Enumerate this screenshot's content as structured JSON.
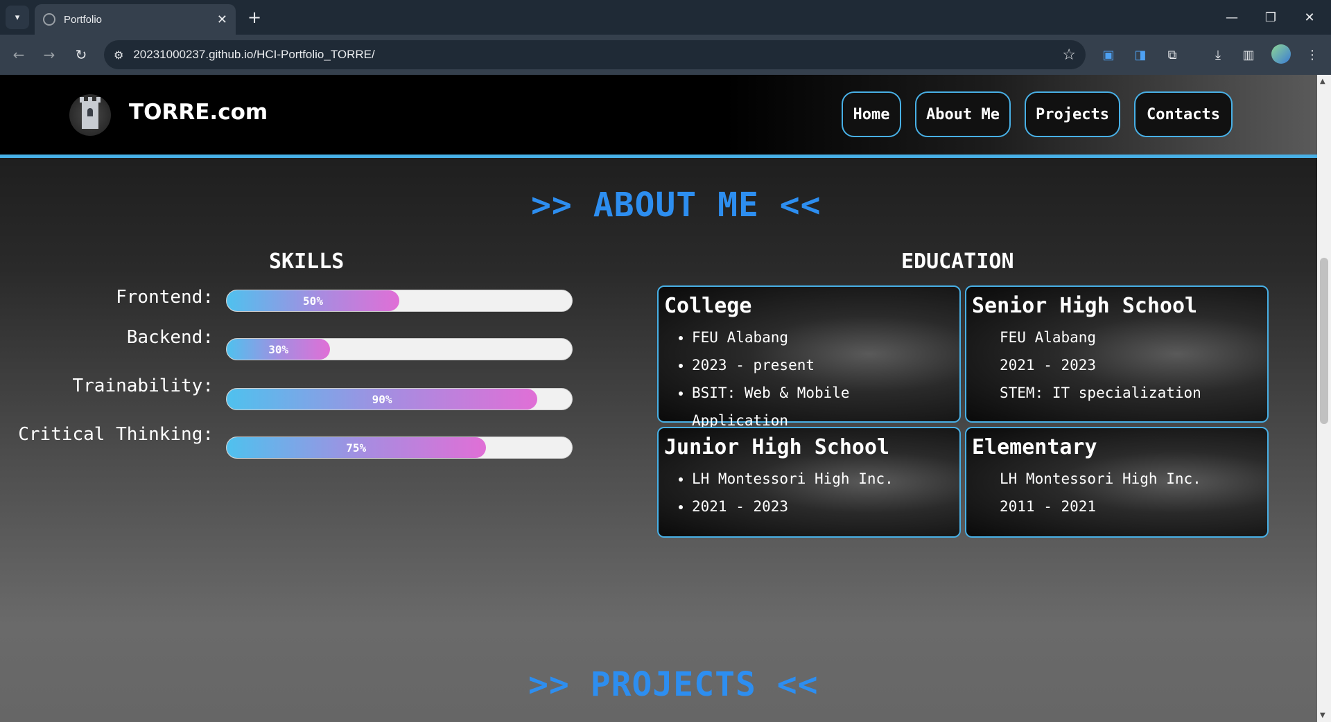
{
  "browser": {
    "tab_title": "Portfolio",
    "url": "20231000237.github.io/HCI-Portfolio_TORRE/"
  },
  "site": {
    "brand": "TORRE.com",
    "nav": [
      "Home",
      "About Me",
      "Projects",
      "Contacts"
    ]
  },
  "about": {
    "title": ">> ABOUT ME <<",
    "skills_heading": "SKILLS",
    "education_heading": "EDUCATION",
    "skills": [
      {
        "label": "Frontend:",
        "percent_text": "50%",
        "percent": 50
      },
      {
        "label": "Backend:",
        "percent_text": "30%",
        "percent": 30
      },
      {
        "label": "Trainability:",
        "percent_text": "90%",
        "percent": 90
      },
      {
        "label": "Critical Thinking:",
        "percent_text": "75%",
        "percent": 75
      }
    ],
    "education": [
      {
        "title": "College",
        "items": [
          "FEU Alabang",
          "2023 - present",
          "BSIT: Web & Mobile Application"
        ]
      },
      {
        "title": "Senior High School",
        "items": [
          "FEU Alabang",
          "2021 - 2023",
          "STEM: IT specialization"
        ]
      },
      {
        "title": "Junior High School",
        "items": [
          "LH Montessori High Inc.",
          "2021 - 2023"
        ]
      },
      {
        "title": "Elementary",
        "items": [
          "LH Montessori High Inc.",
          "2011 - 2021"
        ]
      }
    ]
  },
  "projects": {
    "title": ">> PROJECTS <<"
  }
}
